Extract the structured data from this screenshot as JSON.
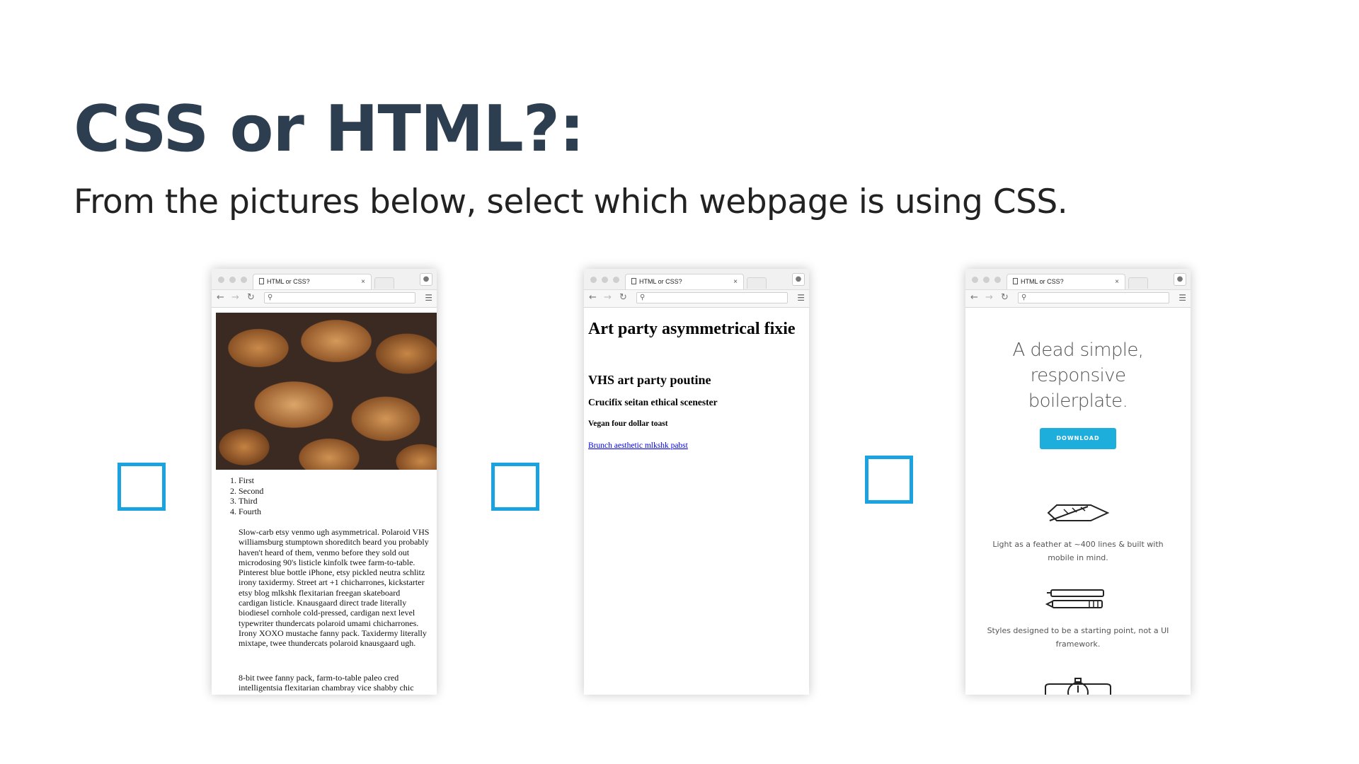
{
  "slide": {
    "title": "CSS or HTML?:",
    "subtitle": "From the pictures below, select which webpage is using CSS."
  },
  "colors": {
    "title": "#2c3e50",
    "checkbox_border": "#1aa3e0",
    "download_button": "#1eaedb",
    "link": "#0000ee"
  },
  "browsers": [
    {
      "tab_title": "HTML or CSS?",
      "list": [
        "First",
        "Second",
        "Third",
        "Fourth"
      ],
      "paragraph1": "Slow-carb etsy venmo ugh asymmetrical. Polaroid VHS williamsburg stumptown shoreditch beard you probably haven't heard of them, venmo before they sold out microdosing 90's listicle kinfolk twee farm-to-table. Pinterest blue bottle iPhone, etsy pickled neutra schlitz irony taxidermy. Street art +1 chicharrones, kickstarter etsy blog mlkshk flexitarian freegan skateboard cardigan listicle. Knausgaard direct trade literally biodiesel cornhole cold-pressed, cardigan next level typewriter thundercats polaroid umami chicharrones. Irony XOXO mustache fanny pack. Taxidermy literally mixtape, twee thundercats polaroid knausgaard ugh.",
      "paragraph2": "8-bit twee fanny pack, farm-to-table paleo cred intelligentsia flexitarian chambray vice shabby chic"
    },
    {
      "tab_title": "HTML or CSS?",
      "h1": "Art party asymmetrical fixie",
      "h2": "VHS art party poutine",
      "h3": "Crucifix seitan ethical scenester",
      "h4": "Vegan four dollar toast",
      "link": "Brunch aesthetic mlkshk pabst"
    },
    {
      "tab_title": "HTML or CSS?",
      "headline": [
        "A dead simple,",
        "responsive",
        "boilerplate."
      ],
      "button": "DOWNLOAD",
      "feature1": "Light as a feather at ~400 lines & built with mobile in mind.",
      "feature2": "Styles designed to be a starting point, not a UI framework."
    }
  ],
  "icons": [
    "page-icon",
    "close-icon",
    "back-arrow-icon",
    "forward-arrow-icon",
    "reload-icon",
    "search-icon",
    "menu-icon",
    "profile-icon",
    "feather-icon",
    "pens-icon",
    "stopwatch-icon"
  ]
}
